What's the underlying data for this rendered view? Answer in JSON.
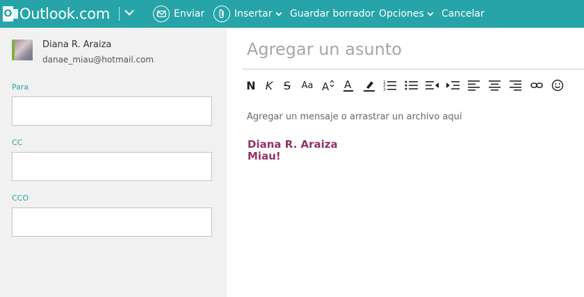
{
  "app": {
    "brand": "Outlook.com",
    "accent": "#26a4a8"
  },
  "toolbar": {
    "send": "Enviar",
    "insert": "Insertar",
    "save_draft": "Guardar borrador",
    "options": "Opciones",
    "cancel": "Cancelar"
  },
  "sender": {
    "name": "Diana R. Araiza",
    "email": "danae_miau@hotmail.com"
  },
  "fields": {
    "to_label": "Para",
    "cc_label": "CC",
    "bcc_label": "CCO"
  },
  "compose": {
    "subject_placeholder": "Agregar un asunto",
    "body_placeholder": "Agregar un mensaje o arrastrar un archivo aquí",
    "signature_line1": "Diana R. Araiza",
    "signature_line2": "Miau!",
    "signature_color": "#933369"
  },
  "format_toolbar": {
    "bold": "N",
    "italic": "K",
    "strike": "S",
    "font_size": "Aa"
  }
}
